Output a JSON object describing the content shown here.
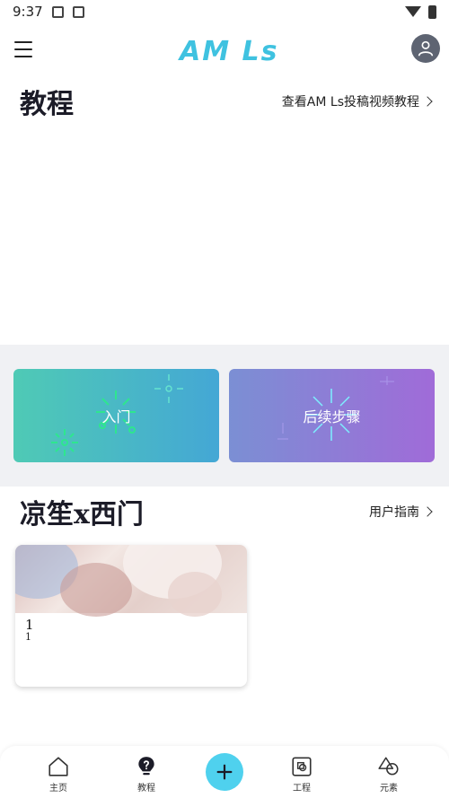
{
  "status_bar": {
    "time": "9:37"
  },
  "app": {
    "logo_text": "AM Ls"
  },
  "tutorials": {
    "title": "教程",
    "video_link": "查看AM Ls投稿视频教程",
    "cards": [
      {
        "label": "入门"
      },
      {
        "label": "后续步骤"
      }
    ]
  },
  "projects": {
    "title": "凉笙x西门",
    "guide_link": "用户指南",
    "items": [
      {
        "name": "1",
        "subtitle": "1"
      }
    ]
  },
  "bottom_nav": {
    "home": "主页",
    "tutorials": "教程",
    "projects": "工程",
    "elements": "元素"
  },
  "colors": {
    "accent": "#4fd1ee",
    "logo": "#3fc2e0",
    "card_start": [
      "#4fcab5",
      "#44a7d5"
    ],
    "card_next": [
      "#7b8fd4",
      "#a06bd8"
    ]
  }
}
